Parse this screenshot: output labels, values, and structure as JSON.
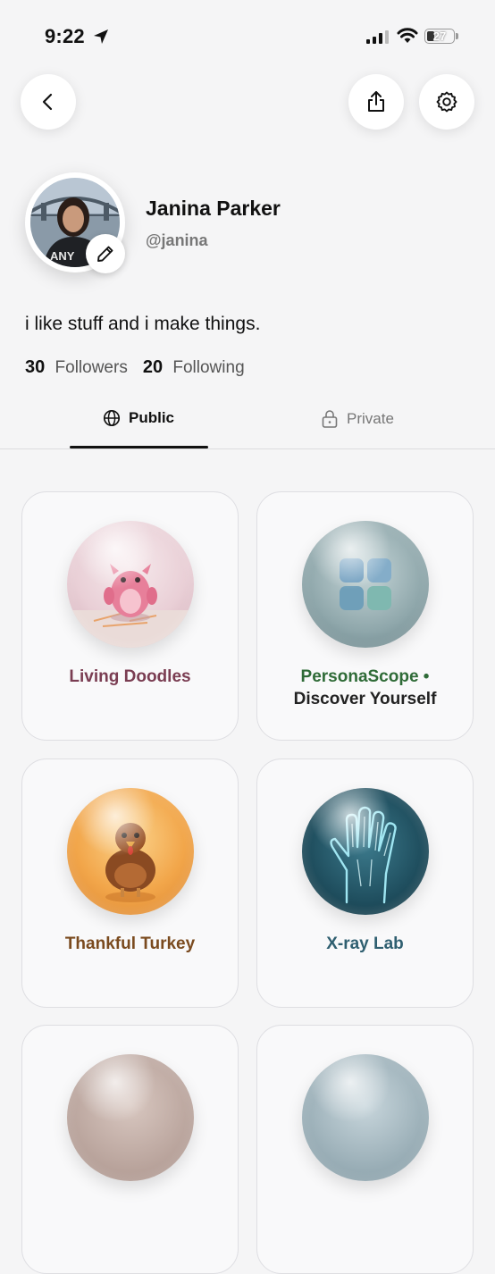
{
  "status_bar": {
    "time": "9:22",
    "battery": "27"
  },
  "profile": {
    "name": "Janina Parker",
    "handle": "@janina",
    "bio": "i like stuff and i make things.",
    "followers_count": "30",
    "followers_label": "Followers",
    "following_count": "20",
    "following_label": "Following"
  },
  "tabs": [
    {
      "label": "Public",
      "active": true
    },
    {
      "label": "Private",
      "active": false
    }
  ],
  "cards": [
    {
      "title": "Living Doodles",
      "color": "#7a3d52"
    },
    {
      "title": "PersonaScope •",
      "title2": "Discover Yourself",
      "color": "#2f6b37",
      "color2": "#222222"
    },
    {
      "title": "Thankful Turkey",
      "color": "#7a4a1e"
    },
    {
      "title": "X-ray Lab",
      "color": "#2f5f70"
    }
  ]
}
